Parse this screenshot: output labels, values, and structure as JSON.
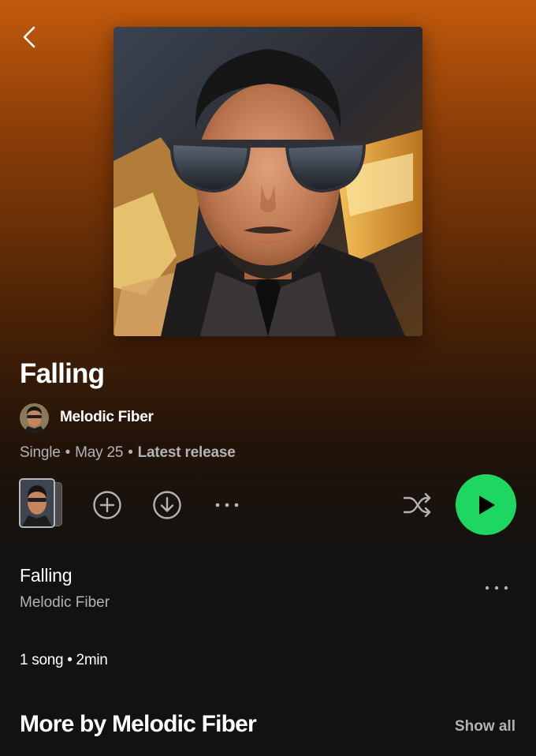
{
  "header": {
    "back_icon": "chevron-left-icon"
  },
  "album": {
    "cover_description_icon": "album-cover-portrait",
    "title": "Falling",
    "artist": "Melodic Fiber",
    "type": "Single",
    "date": "May 25",
    "badge": "Latest release",
    "separator": "•"
  },
  "actions": {
    "add_icon": "plus-circle-icon",
    "download_icon": "download-circle-icon",
    "more_icon": "ellipsis-icon",
    "shuffle_icon": "shuffle-icon",
    "play_icon": "play-icon",
    "play_color": "#1ed760"
  },
  "tracks": [
    {
      "title": "Falling",
      "artist": "Melodic Fiber"
    }
  ],
  "summary": "1 song • 2min",
  "more_by": {
    "heading": "More by Melodic Fiber",
    "show_all": "Show all"
  },
  "colors": {
    "gradient_top": "#c25a0c",
    "background": "#121212",
    "secondary_text": "#b3b3b3"
  }
}
